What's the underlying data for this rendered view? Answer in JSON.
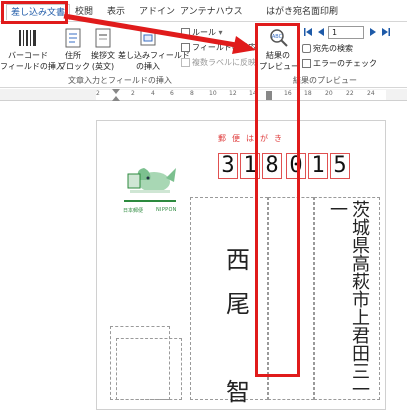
{
  "ribbon": {
    "tabs": [
      {
        "label": "差し込み文書",
        "active": true
      },
      {
        "label": "校閲",
        "active": false
      },
      {
        "label": "表示",
        "active": false
      },
      {
        "label": "アドイン",
        "active": false
      },
      {
        "label": "アンテナハウス",
        "active": false
      },
      {
        "label": "はがき宛名面印刷",
        "active": false
      }
    ],
    "buttons": {
      "barcode": "バーコード\nフィールドの挿入",
      "address_block": "住所\nブロック",
      "greeting": "挨拶文\n(英文)",
      "insert_merge_field": "差し込みフィールド\nの挿入",
      "preview_results": "結果の\nプレビュー"
    },
    "small_items": {
      "rules": "ルール",
      "match_fields": "フィールドの対応",
      "update_labels": "複数ラベルに反映",
      "find_recipient": "宛先の検索",
      "check_errors": "エラーのチェック"
    },
    "record_number": "1",
    "group_labels": {
      "write_insert": "文章入力とフィールドの挿入",
      "preview": "結果のプレビュー"
    }
  },
  "ruler": {
    "numbers": [
      "2",
      "2",
      "4",
      "6",
      "8",
      "10",
      "12",
      "14",
      "16",
      "18",
      "20",
      "22",
      "24"
    ]
  },
  "postcard": {
    "header": "郵便はがき",
    "zip_digits": [
      "3",
      "1",
      "8",
      "0",
      "1",
      "0",
      "5"
    ],
    "address": "茨城県高萩市上君田三一一",
    "name_chars": [
      "西",
      "尾",
      "智"
    ],
    "stamp_label": "日本郵便",
    "nippon_label": "NIPPON"
  },
  "colors": {
    "annotation_red": "#e01b1b",
    "active_tab_text": "#1e5aa8",
    "stamp_green": "#2c8a3e",
    "zip_border": "#e05050"
  }
}
